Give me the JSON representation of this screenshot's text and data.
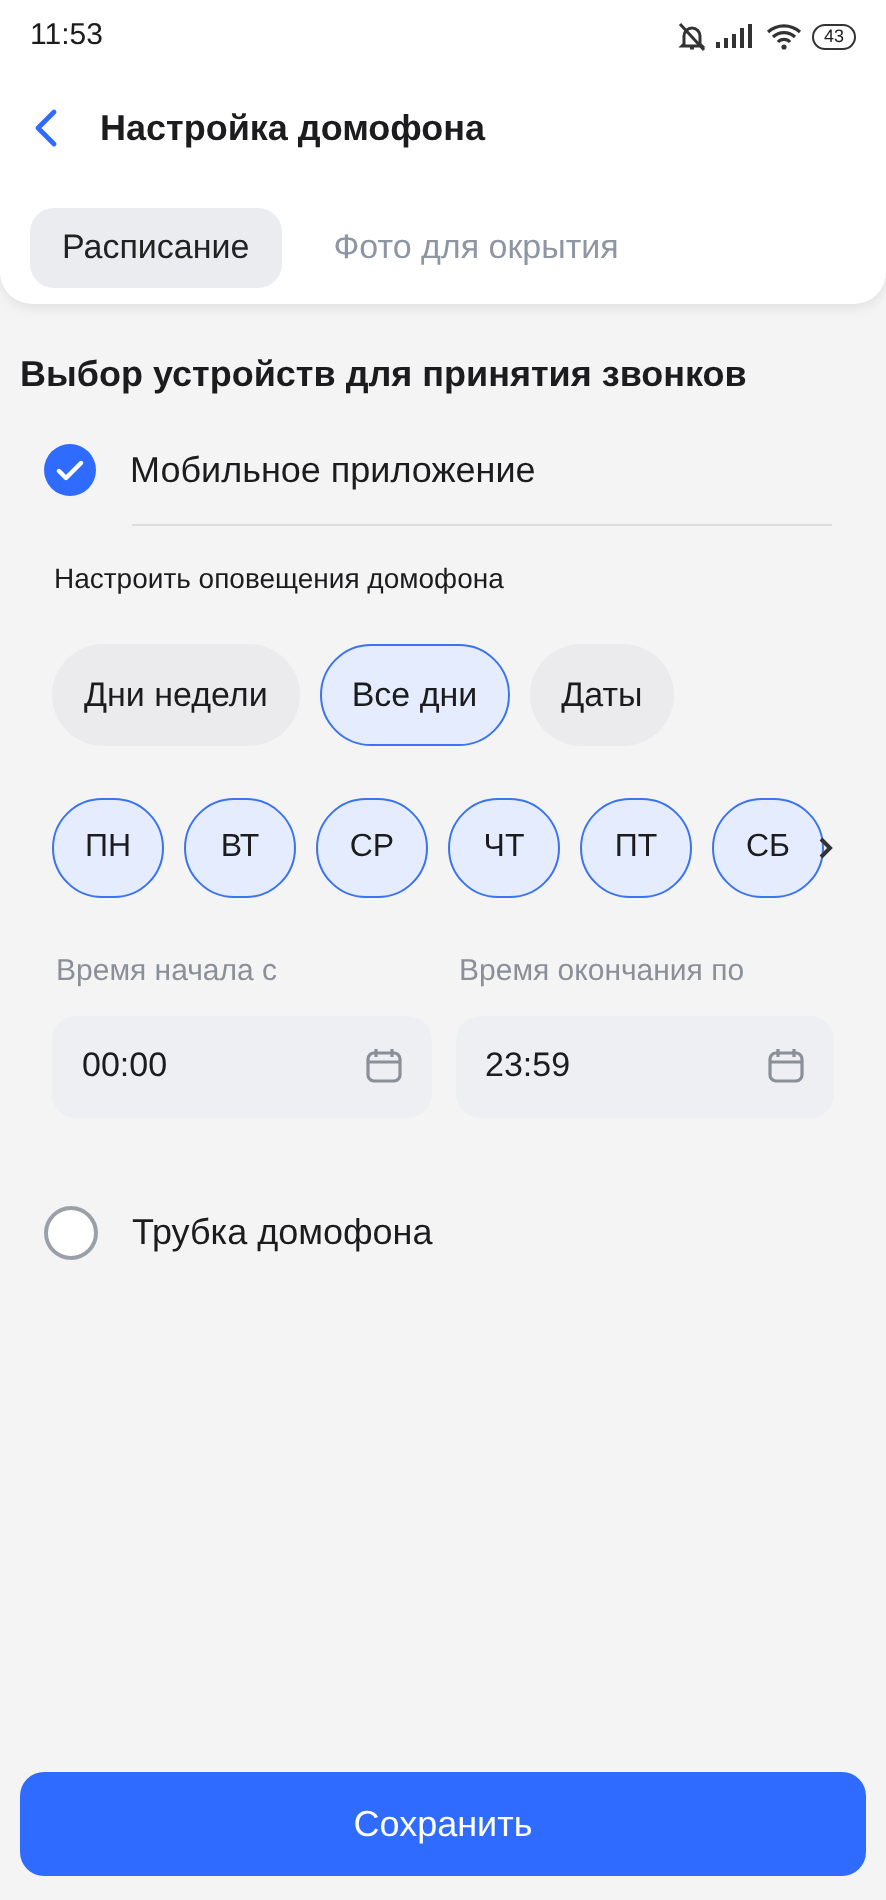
{
  "status_bar": {
    "time": "11:53",
    "battery": "43"
  },
  "header": {
    "title": "Настройка домофона"
  },
  "tabs": [
    {
      "label": "Расписание",
      "selected": true
    },
    {
      "label": "Фото для окрытия",
      "selected": false
    }
  ],
  "section_title": "Выбор устройств для принятия звонков",
  "mobile_app": {
    "label": "Мобильное приложение",
    "checked": true
  },
  "notifications_label": "Настроить оповещения домофона",
  "modes": [
    {
      "label": "Дни недели",
      "selected": false
    },
    {
      "label": "Все дни",
      "selected": true
    },
    {
      "label": "Даты",
      "selected": false
    }
  ],
  "days": [
    {
      "label": "ПН",
      "selected": true
    },
    {
      "label": "ВТ",
      "selected": true
    },
    {
      "label": "СР",
      "selected": true
    },
    {
      "label": "ЧТ",
      "selected": true
    },
    {
      "label": "ПТ",
      "selected": true
    },
    {
      "label": "СБ",
      "selected": true
    }
  ],
  "time_fields": [
    {
      "label": "Время начала с",
      "value": "00:00"
    },
    {
      "label": "Время окончания по",
      "value": "23:59"
    }
  ],
  "handset": {
    "label": "Трубка домофона",
    "checked": false
  },
  "save_button": "Сохранить"
}
